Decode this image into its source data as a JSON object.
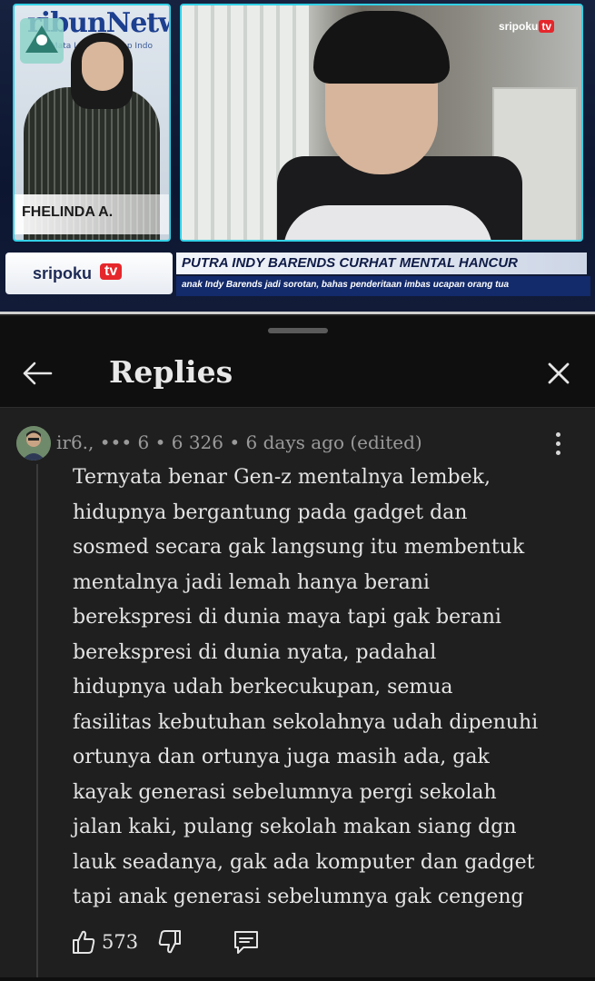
{
  "video": {
    "station_logo_text": "sripoku",
    "station_logo_tv": "tv",
    "studio_backdrop_text": "ribunNetwo",
    "studio_backdrop_sub": "Mata Lokal Lengkap Indo",
    "anchor_name": "FHELINDA A.",
    "ticker_brand": "sripoku",
    "ticker_tv": "tv",
    "headline": "PUTRA INDY BARENDS CURHAT MENTAL HANCUR",
    "subheadline": "anak Indy Barends jadi sorotan, bahas penderitaan imbas ucapan orang tua",
    "progress_fraction": 1.0
  },
  "sheet": {
    "title": "Replies",
    "icons": {
      "back": "arrow-left-icon",
      "close": "close-icon",
      "more": "more-vertical-icon",
      "like": "thumb-up-icon",
      "dislike": "thumb-down-icon",
      "reply": "comment-icon"
    }
  },
  "comment": {
    "meta": "ir6., ••• 6  • 6  326 • 6 days ago (edited)",
    "body": "Ternyata benar Gen-z mentalnya lembek,\nhidupnya bergantung pada gadget dan\nsosmed secara gak langsung itu membentuk\nmentalnya jadi lemah hanya berani\nberekspresi di dunia maya tapi gak berani\nberekspresi di dunia nyata, padahal\nhidupnya udah berkecukupan, semua\nfasilitas kebutuhan sekolahnya udah dipenuhi\nortunya dan ortunya juga masih ada, gak\nkayak generasi sebelumnya pergi sekolah\njalan kaki, pulang sekolah makan siang dgn\nlauk seadanya, gak ada komputer dan gadget\ntapi anak generasi sebelumnya gak cengeng",
    "likes": "573"
  },
  "colors": {
    "sheet_bg": "#0f0f0f",
    "comment_bg": "#1f1f1f",
    "accent_cyan": "#33d1e6",
    "brand_red": "#e5262b"
  }
}
